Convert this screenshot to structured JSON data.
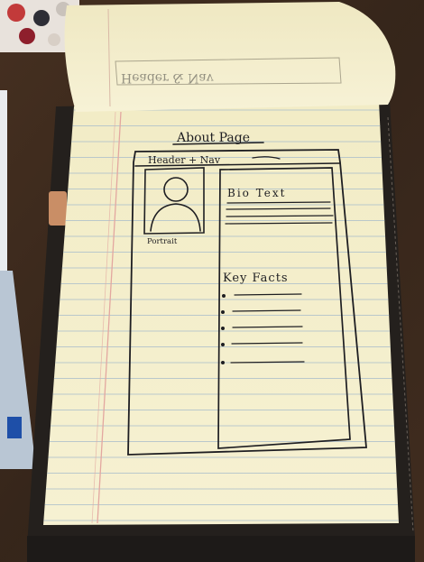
{
  "sketch": {
    "page_title": "About Page",
    "header_nav": "Header + Nav",
    "portrait_label": "Portrait",
    "bio_heading": "Bio Text",
    "facts_heading": "Key Facts",
    "facts_bullets": 5,
    "bio_lines": 4,
    "ghost_text": "Header & Nav"
  },
  "colors": {
    "desk": "#3a2a1f",
    "paper": "#f4efc9",
    "rule_line": "#9fb7c9",
    "margin_line": "#e3a7a0",
    "ink": "#1e1e22",
    "folder": "#2a2622"
  }
}
